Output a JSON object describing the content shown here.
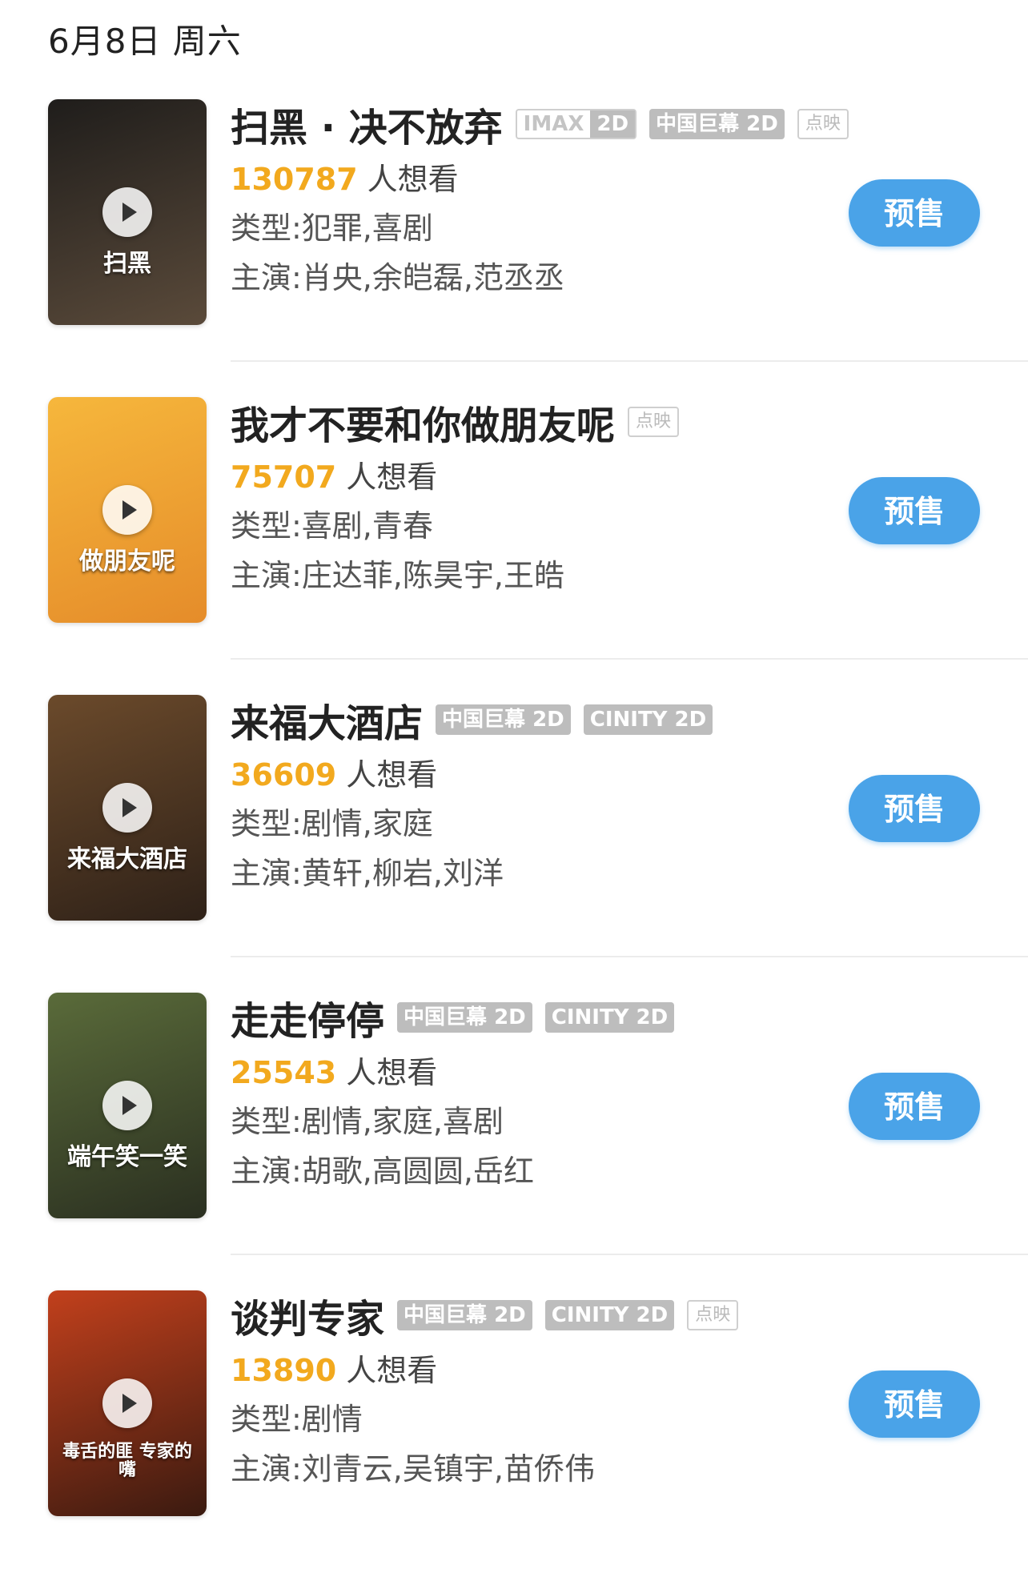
{
  "header": {
    "date": "6月8日 周六"
  },
  "movies": [
    {
      "title": "扫黑 · 决不放弃",
      "tags": [
        {
          "type": "imax",
          "a": "IMAX",
          "b": "2D"
        },
        {
          "type": "solid",
          "label": "中国巨幕 2D"
        },
        {
          "type": "outline",
          "label": "点映"
        }
      ],
      "want_count": "130787",
      "want_suffix": "人想看",
      "genre": "类型:犯罪,喜剧",
      "cast": "主演:肖央,余皑磊,范丞丞",
      "button": "预售",
      "poster_text": "扫黑",
      "poster_colors": [
        "#1f1d1b",
        "#5a4a3a"
      ]
    },
    {
      "title": "我才不要和你做朋友呢",
      "tags": [
        {
          "type": "outline",
          "label": "点映"
        }
      ],
      "want_count": "75707",
      "want_suffix": "人想看",
      "genre": "类型:喜剧,青春",
      "cast": "主演:庄达菲,陈昊宇,王皓",
      "button": "预售",
      "poster_text": "做朋友呢",
      "poster_colors": [
        "#f6b73c",
        "#e58c2a"
      ]
    },
    {
      "title": "来福大酒店",
      "tags": [
        {
          "type": "solid",
          "label": "中国巨幕 2D"
        },
        {
          "type": "solid",
          "label": "CINITY 2D"
        }
      ],
      "want_count": "36609",
      "want_suffix": "人想看",
      "genre": "类型:剧情,家庭",
      "cast": "主演:黄轩,柳岩,刘洋",
      "button": "预售",
      "poster_text": "来福大酒店",
      "poster_colors": [
        "#6b4a2b",
        "#2e2118"
      ]
    },
    {
      "title": "走走停停",
      "tags": [
        {
          "type": "solid",
          "label": "中国巨幕 2D"
        },
        {
          "type": "solid",
          "label": "CINITY 2D"
        }
      ],
      "want_count": "25543",
      "want_suffix": "人想看",
      "genre": "类型:剧情,家庭,喜剧",
      "cast": "主演:胡歌,高圆圆,岳红",
      "button": "预售",
      "poster_text": "端午笑一笑",
      "poster_colors": [
        "#5a6b3a",
        "#2a2f20"
      ]
    },
    {
      "title": "谈判专家",
      "tags": [
        {
          "type": "solid",
          "label": "中国巨幕 2D"
        },
        {
          "type": "solid",
          "label": "CINITY 2D"
        },
        {
          "type": "outline",
          "label": "点映"
        }
      ],
      "want_count": "13890",
      "want_suffix": "人想看",
      "genre": "类型:剧情",
      "cast": "主演:刘青云,吴镇宇,苗侨伟",
      "button": "预售",
      "poster_text": "毒舌的匪 专家的嘴",
      "poster_colors": [
        "#c2401c",
        "#3a1a10"
      ]
    }
  ]
}
